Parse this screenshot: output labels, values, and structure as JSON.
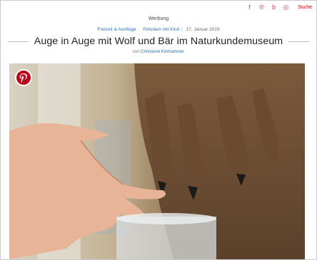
{
  "header": {
    "social_icons": [
      "facebook-icon",
      "pinterest-icon",
      "bloglovin-icon",
      "instagram-icon"
    ],
    "search_label": "Suche"
  },
  "article": {
    "ad_label": "Werbung",
    "categories": [
      "Freizeit & Ausflüge",
      "Potsdam mit Kind"
    ],
    "date": "17. Januar 2019",
    "title": "Auge in Auge mit Wolf und Bär im Naturkundemuseum",
    "byline_prefix": "von",
    "author": "Christiane Kirkhammer"
  },
  "image": {
    "description_icon": "pinterest-save-icon"
  },
  "colors": {
    "accent": "#c00000",
    "link": "#2f6fb0",
    "pinterest": "#bd081c"
  }
}
